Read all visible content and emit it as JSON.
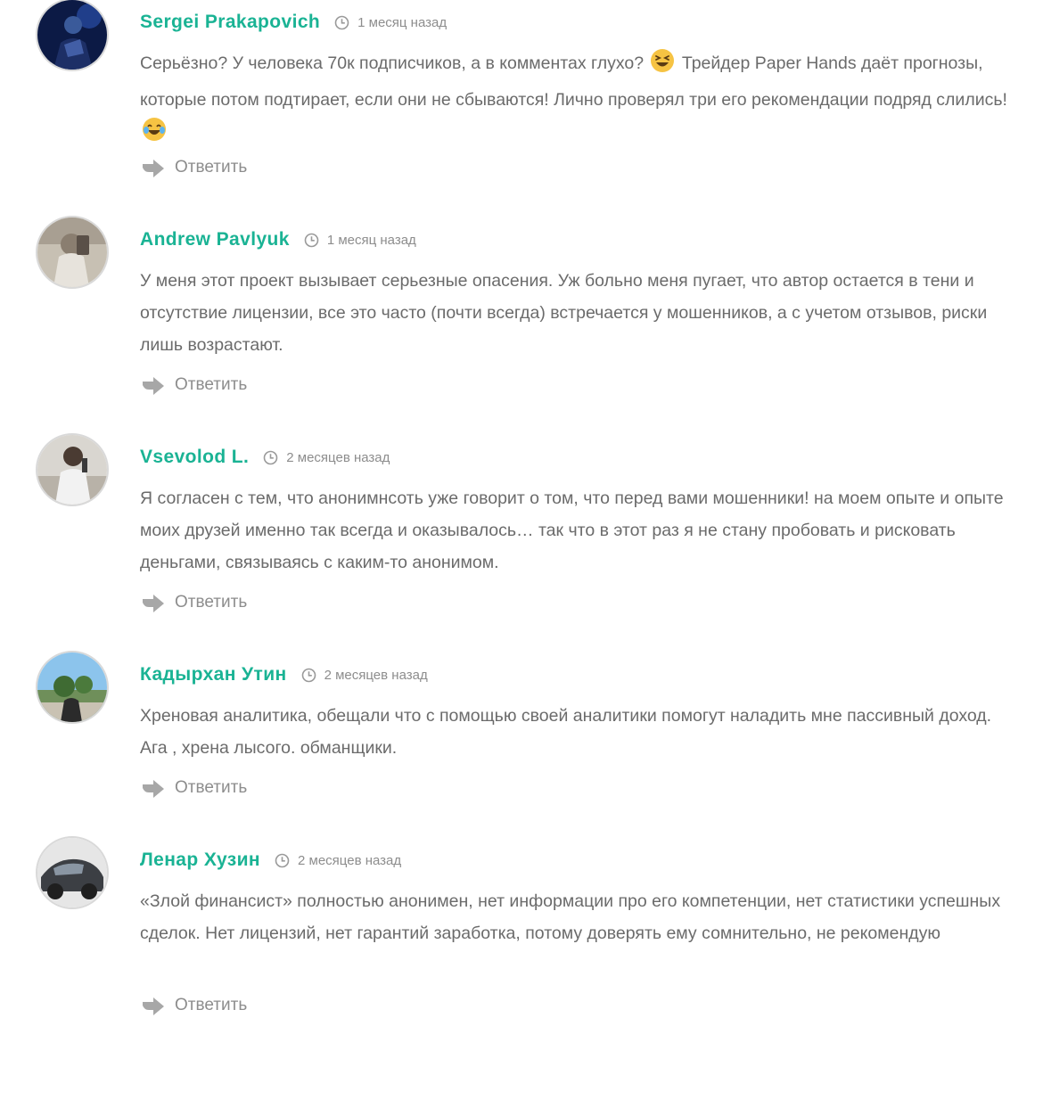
{
  "comments": [
    {
      "author": "Sergei Prakapovich",
      "time": "1 месяц назад",
      "text_parts": [
        "Серьёзно? У человека 70к подписчиков, а в комментах глухо?",
        "Трейдер Paper Hands даёт прогнозы, которые потом подтирает, если они не сбываются! Лично проверял три его рекомендации подряд слились!"
      ],
      "emojis": [
        "grinning-squinting-face-emoji",
        "face-with-tears-of-joy-emoji"
      ],
      "reply_label": "Ответить"
    },
    {
      "author": "Andrew Pavlyuk",
      "time": "1 месяц назад",
      "text": "У меня этот проект вызывает серьезные опасения. Уж больно меня пугает, что автор остается в тени и отсутствие лицензии, все это часто (почти всегда) встречается у мошенников, а с учетом отзывов, риски лишь возрастают.",
      "reply_label": "Ответить"
    },
    {
      "author": "Vsevolod L.",
      "time": "2 месяцев назад",
      "text": "Я согласен с тем, что анонимнсоть уже говорит о том, что перед вами мошенники! на моем опыте и опыте моих друзей именно так всегда и оказывалось… так что в этот раз я не стану пробовать и рисковать деньгами, связываясь с каким-то анонимом.",
      "reply_label": "Ответить"
    },
    {
      "author": "Кадырхан Утин",
      "time": "2 месяцев назад",
      "text": "Хреновая аналитика, обещали что с помощью своей аналитики помогут наладить мне пассивный доход. Ага , хрена лысого. обманщики.",
      "reply_label": "Ответить"
    },
    {
      "author": "Ленар Хузин",
      "time": "2 месяцев назад",
      "text": "«Злой финансист» полностью анонимен, нет информации про его компетенции, нет статистики успешных сделок. Нет лицензий, нет гарантий заработка, потому доверять ему сомнительно, не рекомендую",
      "reply_label": "Ответить"
    }
  ],
  "colors": {
    "author": "#1ab394",
    "text": "#6b6b6b",
    "meta": "#8d8d8d",
    "avatar_border": "#d9d9d9"
  },
  "icons": {
    "time": "clock-icon",
    "reply": "reply-arrow-icon"
  }
}
